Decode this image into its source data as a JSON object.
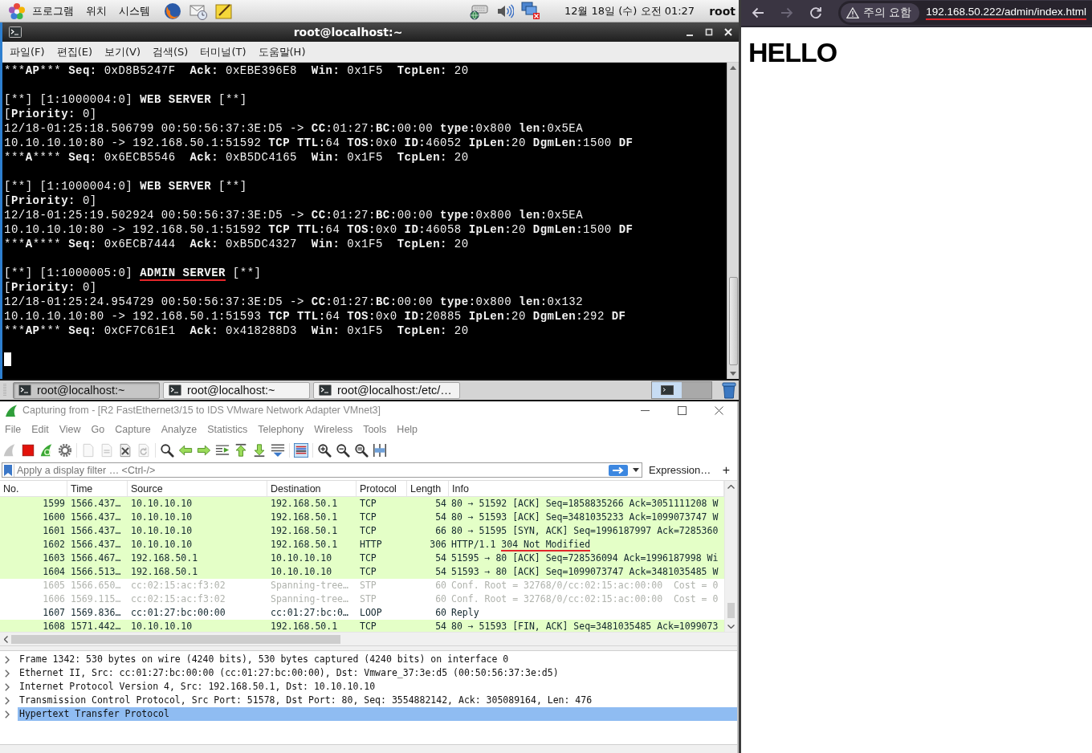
{
  "top_panel": {
    "menus": [
      "프로그램",
      "위치",
      "시스템"
    ],
    "clock": "12월 18일 (수) 오전 01:27",
    "user": "root"
  },
  "terminal": {
    "title": "root@localhost:~",
    "menus": [
      "파일(F)",
      "편집(E)",
      "보기(V)",
      "검색(S)",
      "터미널(T)",
      "도움말(H)"
    ],
    "cursor": true,
    "blocks": [
      {
        "lines": [
          [
            {
              "text": "***",
              "kind": "plain"
            },
            {
              "text": "AP",
              "kind": "bold"
            },
            {
              "text": "*** ",
              "kind": "plain"
            },
            {
              "text": "Seq:",
              "kind": "bold"
            },
            {
              "text": " 0xD8B5247F  ",
              "kind": "plain"
            },
            {
              "text": "Ack:",
              "kind": "bold"
            },
            {
              "text": " 0xEBE396E8  ",
              "kind": "plain"
            },
            {
              "text": "Win:",
              "kind": "bold"
            },
            {
              "text": " 0x1F5  ",
              "kind": "plain"
            },
            {
              "text": "TcpLen:",
              "kind": "bold"
            },
            {
              "text": " 20",
              "kind": "plain"
            }
          ]
        ]
      },
      {
        "lines": [
          [
            {
              "text": "[**] [1:1000004:0] ",
              "kind": "plain"
            },
            {
              "text": "WEB SERVER",
              "kind": "bold"
            },
            {
              "text": " [**]",
              "kind": "plain"
            }
          ],
          [
            {
              "text": "[",
              "kind": "plain"
            },
            {
              "text": "Priority:",
              "kind": "bold"
            },
            {
              "text": " 0]",
              "kind": "plain"
            }
          ],
          [
            {
              "text": "12/18-01:25:18.506799 00:50:56:37:3E:D5 -> ",
              "kind": "plain"
            },
            {
              "text": "CC:",
              "kind": "bold"
            },
            {
              "text": "01:27:",
              "kind": "plain"
            },
            {
              "text": "BC:",
              "kind": "bold"
            },
            {
              "text": "00:00 ",
              "kind": "plain"
            },
            {
              "text": "type:",
              "kind": "bold"
            },
            {
              "text": "0x800 ",
              "kind": "plain"
            },
            {
              "text": "len:",
              "kind": "bold"
            },
            {
              "text": "0x5EA",
              "kind": "plain"
            }
          ],
          [
            {
              "text": "10.10.10.10:80 -> 192.168.50.1:51592 ",
              "kind": "plain"
            },
            {
              "text": "TCP TTL:",
              "kind": "bold"
            },
            {
              "text": "64 ",
              "kind": "plain"
            },
            {
              "text": "TOS:",
              "kind": "bold"
            },
            {
              "text": "0x0 ",
              "kind": "plain"
            },
            {
              "text": "ID:",
              "kind": "bold"
            },
            {
              "text": "46052 ",
              "kind": "plain"
            },
            {
              "text": "IpLen:",
              "kind": "bold"
            },
            {
              "text": "20 ",
              "kind": "plain"
            },
            {
              "text": "DgmLen:",
              "kind": "bold"
            },
            {
              "text": "1500 ",
              "kind": "plain"
            },
            {
              "text": "DF",
              "kind": "bold"
            }
          ],
          [
            {
              "text": "***",
              "kind": "plain"
            },
            {
              "text": "A",
              "kind": "bold"
            },
            {
              "text": "**** ",
              "kind": "plain"
            },
            {
              "text": "Seq:",
              "kind": "bold"
            },
            {
              "text": " 0x6ECB5546  ",
              "kind": "plain"
            },
            {
              "text": "Ack:",
              "kind": "bold"
            },
            {
              "text": " 0xB5DC4165  ",
              "kind": "plain"
            },
            {
              "text": "Win:",
              "kind": "bold"
            },
            {
              "text": " 0x1F5  ",
              "kind": "plain"
            },
            {
              "text": "TcpLen:",
              "kind": "bold"
            },
            {
              "text": " 20",
              "kind": "plain"
            }
          ]
        ]
      },
      {
        "lines": [
          [
            {
              "text": "[**] [1:1000004:0] ",
              "kind": "plain"
            },
            {
              "text": "WEB SERVER",
              "kind": "bold"
            },
            {
              "text": " [**]",
              "kind": "plain"
            }
          ],
          [
            {
              "text": "[",
              "kind": "plain"
            },
            {
              "text": "Priority:",
              "kind": "bold"
            },
            {
              "text": " 0]",
              "kind": "plain"
            }
          ],
          [
            {
              "text": "12/18-01:25:19.502924 00:50:56:37:3E:D5 -> ",
              "kind": "plain"
            },
            {
              "text": "CC:",
              "kind": "bold"
            },
            {
              "text": "01:27:",
              "kind": "plain"
            },
            {
              "text": "BC:",
              "kind": "bold"
            },
            {
              "text": "00:00 ",
              "kind": "plain"
            },
            {
              "text": "type:",
              "kind": "bold"
            },
            {
              "text": "0x800 ",
              "kind": "plain"
            },
            {
              "text": "len:",
              "kind": "bold"
            },
            {
              "text": "0x5EA",
              "kind": "plain"
            }
          ],
          [
            {
              "text": "10.10.10.10:80 -> 192.168.50.1:51592 ",
              "kind": "plain"
            },
            {
              "text": "TCP TTL:",
              "kind": "bold"
            },
            {
              "text": "64 ",
              "kind": "plain"
            },
            {
              "text": "TOS:",
              "kind": "bold"
            },
            {
              "text": "0x0 ",
              "kind": "plain"
            },
            {
              "text": "ID:",
              "kind": "bold"
            },
            {
              "text": "46058 ",
              "kind": "plain"
            },
            {
              "text": "IpLen:",
              "kind": "bold"
            },
            {
              "text": "20 ",
              "kind": "plain"
            },
            {
              "text": "DgmLen:",
              "kind": "bold"
            },
            {
              "text": "1500 ",
              "kind": "plain"
            },
            {
              "text": "DF",
              "kind": "bold"
            }
          ],
          [
            {
              "text": "***",
              "kind": "plain"
            },
            {
              "text": "A",
              "kind": "bold"
            },
            {
              "text": "**** ",
              "kind": "plain"
            },
            {
              "text": "Seq:",
              "kind": "bold"
            },
            {
              "text": " 0x6ECB7444  ",
              "kind": "plain"
            },
            {
              "text": "Ack:",
              "kind": "bold"
            },
            {
              "text": " 0xB5DC4327  ",
              "kind": "plain"
            },
            {
              "text": "Win:",
              "kind": "bold"
            },
            {
              "text": " 0x1F5  ",
              "kind": "plain"
            },
            {
              "text": "TcpLen:",
              "kind": "bold"
            },
            {
              "text": " 20",
              "kind": "plain"
            }
          ]
        ]
      },
      {
        "lines": [
          [
            {
              "text": "[**] [1:1000005:0] ",
              "kind": "plain"
            },
            {
              "text": "ADMIN SERVER",
              "kind": "marked"
            },
            {
              "text": " [**]",
              "kind": "plain"
            }
          ],
          [
            {
              "text": "[",
              "kind": "plain"
            },
            {
              "text": "Priority:",
              "kind": "bold"
            },
            {
              "text": " 0]",
              "kind": "plain"
            }
          ],
          [
            {
              "text": "12/18-01:25:24.954729 00:50:56:37:3E:D5 -> ",
              "kind": "plain"
            },
            {
              "text": "CC:",
              "kind": "bold"
            },
            {
              "text": "01:27:",
              "kind": "plain"
            },
            {
              "text": "BC:",
              "kind": "bold"
            },
            {
              "text": "00:00 ",
              "kind": "plain"
            },
            {
              "text": "type:",
              "kind": "bold"
            },
            {
              "text": "0x800 ",
              "kind": "plain"
            },
            {
              "text": "len:",
              "kind": "bold"
            },
            {
              "text": "0x132",
              "kind": "plain"
            }
          ],
          [
            {
              "text": "10.10.10.10:80 -> 192.168.50.1:51593 ",
              "kind": "plain"
            },
            {
              "text": "TCP TTL:",
              "kind": "bold"
            },
            {
              "text": "64 ",
              "kind": "plain"
            },
            {
              "text": "TOS:",
              "kind": "bold"
            },
            {
              "text": "0x0 ",
              "kind": "plain"
            },
            {
              "text": "ID:",
              "kind": "bold"
            },
            {
              "text": "20885 ",
              "kind": "plain"
            },
            {
              "text": "IpLen:",
              "kind": "bold"
            },
            {
              "text": "20 ",
              "kind": "plain"
            },
            {
              "text": "DgmLen:",
              "kind": "bold"
            },
            {
              "text": "292 ",
              "kind": "plain"
            },
            {
              "text": "DF",
              "kind": "bold"
            }
          ],
          [
            {
              "text": "***",
              "kind": "plain"
            },
            {
              "text": "AP",
              "kind": "bold"
            },
            {
              "text": "*** ",
              "kind": "plain"
            },
            {
              "text": "Seq:",
              "kind": "bold"
            },
            {
              "text": " 0xCF7C61E1  ",
              "kind": "plain"
            },
            {
              "text": "Ack:",
              "kind": "bold"
            },
            {
              "text": " 0x418288D3  ",
              "kind": "plain"
            },
            {
              "text": "Win:",
              "kind": "bold"
            },
            {
              "text": " 0x1F5  ",
              "kind": "plain"
            },
            {
              "text": "TcpLen:",
              "kind": "bold"
            },
            {
              "text": " 20",
              "kind": "plain"
            }
          ]
        ]
      }
    ]
  },
  "taskbar": {
    "items": [
      {
        "label": "root@localhost:~",
        "selected": true
      },
      {
        "label": "root@localhost:~",
        "selected": false
      },
      {
        "label": "root@localhost:/etc/…",
        "selected": false
      }
    ],
    "workspaces": [
      {
        "selected": true
      },
      {
        "selected": false
      }
    ]
  },
  "wireshark": {
    "title": "Capturing from - [R2 FastEthernet3/15 to IDS VMware Network Adapter VMnet3]",
    "menus": [
      "File",
      "Edit",
      "View",
      "Go",
      "Capture",
      "Analyze",
      "Statistics",
      "Telephony",
      "Wireless",
      "Tools",
      "Help"
    ],
    "toolbar": [
      {
        "buttons": [
          {
            "kind": "start",
            "disabled": true,
            "pressed": false
          },
          {
            "kind": "stop",
            "disabled": false,
            "pressed": false
          },
          {
            "kind": "restart",
            "disabled": false,
            "pressed": false
          },
          {
            "kind": "options",
            "disabled": false,
            "pressed": false
          }
        ]
      },
      {
        "buttons": [
          {
            "kind": "open",
            "disabled": true,
            "pressed": false
          },
          {
            "kind": "save",
            "disabled": true,
            "pressed": false
          },
          {
            "kind": "close",
            "disabled": false,
            "pressed": false
          },
          {
            "kind": "reload",
            "disabled": true,
            "pressed": false
          }
        ]
      },
      {
        "buttons": [
          {
            "kind": "find",
            "disabled": false,
            "pressed": false
          },
          {
            "kind": "back",
            "disabled": false,
            "pressed": false
          },
          {
            "kind": "forward",
            "disabled": false,
            "pressed": false
          },
          {
            "kind": "goto",
            "disabled": false,
            "pressed": false
          },
          {
            "kind": "first",
            "disabled": false,
            "pressed": false
          },
          {
            "kind": "last",
            "disabled": false,
            "pressed": false
          },
          {
            "kind": "autoscroll",
            "disabled": false,
            "pressed": false
          }
        ]
      },
      {
        "buttons": [
          {
            "kind": "colorize",
            "disabled": false,
            "pressed": true
          }
        ]
      },
      {
        "buttons": [
          {
            "kind": "zoom_in",
            "disabled": false,
            "pressed": false
          },
          {
            "kind": "zoom_out",
            "disabled": false,
            "pressed": false
          },
          {
            "kind": "zoom_reset",
            "disabled": false,
            "pressed": false
          },
          {
            "kind": "resize_columns",
            "disabled": false,
            "pressed": false
          }
        ]
      }
    ],
    "filter": {
      "placeholder": "Apply a display filter … <Ctrl-/>"
    },
    "expression": "Expression…",
    "add": "+",
    "columns": [
      "No.",
      "Time",
      "Source",
      "Destination",
      "Protocol",
      "Length",
      "Info"
    ],
    "rows": [
      {
        "no": "1599",
        "time": "1566.437…",
        "source": "10.10.10.10",
        "destination": "192.168.50.1",
        "protocol": "TCP",
        "length": "54",
        "info": [
          {
            "text": "80 → 51592 [ACK] Seq=1858835266 Ack=3051111208 W",
            "kind": "plain"
          }
        ],
        "color": "#e4ffc7",
        "dimmed": false,
        "selected": false
      },
      {
        "no": "1600",
        "time": "1566.437…",
        "source": "10.10.10.10",
        "destination": "192.168.50.1",
        "protocol": "TCP",
        "length": "54",
        "info": [
          {
            "text": "80 → 51593 [ACK] Seq=3481035233 Ack=1099073747 W",
            "kind": "plain"
          }
        ],
        "color": "#e4ffc7",
        "dimmed": false,
        "selected": false
      },
      {
        "no": "1601",
        "time": "1566.437…",
        "source": "10.10.10.10",
        "destination": "192.168.50.1",
        "protocol": "TCP",
        "length": "66",
        "info": [
          {
            "text": "80 → 51595 [SYN, ACK] Seq=1996187997 Ack=7285360",
            "kind": "plain"
          }
        ],
        "color": "#e4ffc7",
        "dimmed": false,
        "selected": false
      },
      {
        "no": "1602",
        "time": "1566.437…",
        "source": "10.10.10.10",
        "destination": "192.168.50.1",
        "protocol": "HTTP",
        "length": "306",
        "info": [
          {
            "text": "HTTP/1.1 ",
            "kind": "plain"
          },
          {
            "text": "304 Not Modified",
            "kind": "marked"
          }
        ],
        "color": "#e4ffc7",
        "dimmed": false,
        "selected": false
      },
      {
        "no": "1603",
        "time": "1566.467…",
        "source": "192.168.50.1",
        "destination": "10.10.10.10",
        "protocol": "TCP",
        "length": "54",
        "info": [
          {
            "text": "51595 → 80 [ACK] Seq=728536094 Ack=1996187998 Wi",
            "kind": "plain"
          }
        ],
        "color": "#e4ffc7",
        "dimmed": false,
        "selected": false
      },
      {
        "no": "1604",
        "time": "1566.513…",
        "source": "192.168.50.1",
        "destination": "10.10.10.10",
        "protocol": "TCP",
        "length": "54",
        "info": [
          {
            "text": "51593 → 80 [ACK] Seq=1099073747 Ack=3481035485 W",
            "kind": "plain"
          }
        ],
        "color": "#e4ffc7",
        "dimmed": false,
        "selected": false
      },
      {
        "no": "1605",
        "time": "1566.650…",
        "source": "cc:02:15:ac:f3:02",
        "destination": "Spanning-tree…",
        "protocol": "STP",
        "length": "60",
        "info": [
          {
            "text": "Conf. Root = 32768/0/cc:02:15:ac:00:00  Cost = 0",
            "kind": "plain"
          }
        ],
        "color": "#ffffff",
        "dimmed": true,
        "selected": false
      },
      {
        "no": "1606",
        "time": "1569.115…",
        "source": "cc:02:15:ac:f3:02",
        "destination": "Spanning-tree…",
        "protocol": "STP",
        "length": "60",
        "info": [
          {
            "text": "Conf. Root = 32768/0/cc:02:15:ac:00:00  Cost = 0",
            "kind": "plain"
          }
        ],
        "color": "#ffffff",
        "dimmed": true,
        "selected": false
      },
      {
        "no": "1607",
        "time": "1569.836…",
        "source": "cc:01:27:bc:00:00",
        "destination": "cc:01:27:bc:0…",
        "protocol": "LOOP",
        "length": "60",
        "info": [
          {
            "text": "Reply",
            "kind": "plain"
          }
        ],
        "color": "#ffffff",
        "dimmed": false,
        "selected": false
      },
      {
        "no": "1608",
        "time": "1571.442…",
        "source": "10.10.10.10",
        "destination": "192.168.50.1",
        "protocol": "TCP",
        "length": "54",
        "info": [
          {
            "text": "80 → 51593 [FIN, ACK] Seq=3481035485 Ack=1099073",
            "kind": "plain"
          }
        ],
        "color": "#e4ffc7",
        "dimmed": false,
        "selected": false
      }
    ],
    "details": [
      {
        "label": "Frame 1342: 530 bytes on wire (4240 bits), 530 bytes captured (4240 bits) on interface 0",
        "expanded": false,
        "selected": false
      },
      {
        "label": "Ethernet II, Src: cc:01:27:bc:00:00 (cc:01:27:bc:00:00), Dst: Vmware_37:3e:d5 (00:50:56:37:3e:d5)",
        "expanded": false,
        "selected": false
      },
      {
        "label": "Internet Protocol Version 4, Src: 192.168.50.1, Dst: 10.10.10.10",
        "expanded": false,
        "selected": false
      },
      {
        "label": "Transmission Control Protocol, Src Port: 51578, Dst Port: 80, Seq: 3554882142, Ack: 305089164, Len: 476",
        "expanded": false,
        "selected": false
      },
      {
        "label": "Hypertext Transfer Protocol",
        "expanded": false,
        "selected": true
      }
    ]
  },
  "browser": {
    "nav": [
      {
        "kind": "back",
        "disabled": false
      },
      {
        "kind": "forward",
        "disabled": true
      },
      {
        "kind": "reload",
        "disabled": false
      }
    ],
    "security": "주의 요함",
    "url": "192.168.50.222/admin/index.html",
    "marked": true,
    "heading": "HELLO"
  }
}
